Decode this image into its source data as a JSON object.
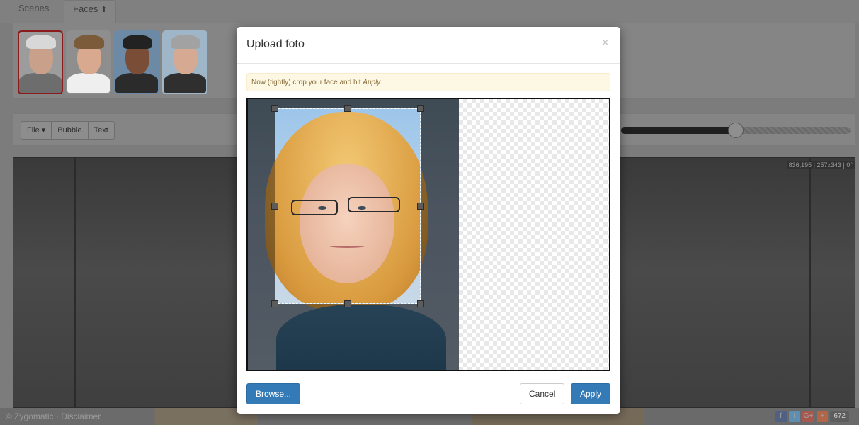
{
  "tabs": [
    {
      "label": "Scenes",
      "active": false
    },
    {
      "label": "Faces",
      "active": true,
      "icon": "upload-icon"
    }
  ],
  "faces": {
    "thumbnails": [
      {
        "id": "face-1",
        "selected": true,
        "skin": "#c9a08a",
        "hair": "#d8d8d8",
        "bg": "#9c9c9c",
        "clothes": "#6d6d6d"
      },
      {
        "id": "face-2",
        "selected": false,
        "skin": "#d8a98f",
        "hair": "#7b5b3a",
        "bg": "#8e8e8e",
        "clothes": "#efefef"
      },
      {
        "id": "face-3",
        "selected": false,
        "skin": "#7a4e36",
        "hair": "#222222",
        "bg": "#6c8aa5",
        "clothes": "#2b2b2b"
      },
      {
        "id": "face-4",
        "selected": false,
        "skin": "#d6aa92",
        "hair": "#a2a2a2",
        "bg": "#9fb5c8",
        "clothes": "#2f2f2f"
      }
    ],
    "side_buttons": [
      {
        "icon": "upload-icon",
        "glyph": "⬆"
      },
      {
        "icon": "camera-icon",
        "glyph": "◘"
      }
    ]
  },
  "toolbar": {
    "file_label": "File",
    "file_caret": "▾",
    "bubble_label": "Bubble",
    "text_label": "Text",
    "slider_value": 0.5
  },
  "canvas": {
    "coords": "836,195 | 257x343 | 0°"
  },
  "footer": {
    "copyright": "© Zygomatic · Disclaimer",
    "social": [
      {
        "icon": "facebook-icon",
        "glyph": "f",
        "color": "#3b5998"
      },
      {
        "icon": "twitter-icon",
        "glyph": "t",
        "color": "#55acee"
      },
      {
        "icon": "googleplus-icon",
        "glyph": "G+",
        "color": "#dd4b39"
      },
      {
        "icon": "addthis-icon",
        "glyph": "+",
        "color": "#f0612b"
      }
    ],
    "share_count": "672"
  },
  "modal": {
    "title": "Upload foto",
    "close_glyph": "×",
    "instruction_prefix": "Now (tightly) crop your face and hit ",
    "instruction_emph": "Apply",
    "instruction_suffix": ".",
    "browse_label": "Browse...",
    "cancel_label": "Cancel",
    "apply_label": "Apply"
  },
  "colors": {
    "primary": "#337ab7",
    "alert_bg": "#fcf8e3",
    "alert_text": "#8a6d3b"
  }
}
